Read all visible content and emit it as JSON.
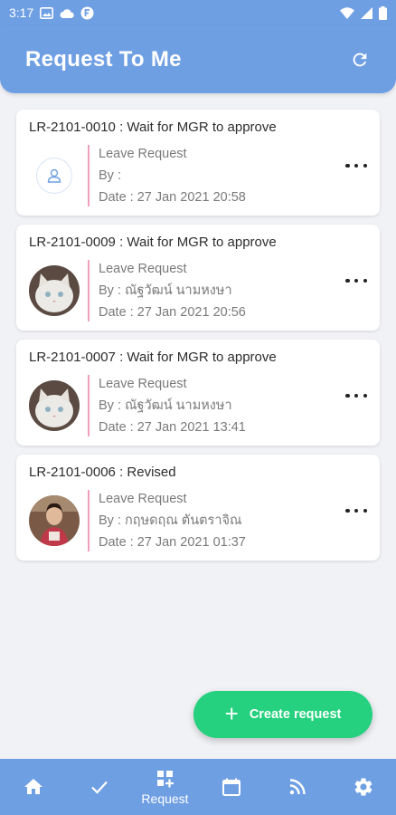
{
  "status_bar": {
    "time": "3:17"
  },
  "header": {
    "title": "Request To Me"
  },
  "requests": [
    {
      "title": "LR-2101-0010 : Wait for MGR to approve",
      "type": "Leave Request",
      "by": "By :",
      "date": "Date : 27 Jan 2021 20:58",
      "avatar": "placeholder"
    },
    {
      "title": "LR-2101-0009 : Wait for MGR to approve",
      "type": "Leave Request",
      "by": "By : ณัฐวัฒน์ นามหงษา",
      "date": "Date : 27 Jan 2021 20:56",
      "avatar": "cat"
    },
    {
      "title": "LR-2101-0007 : Wait for MGR to approve",
      "type": "Leave Request",
      "by": "By : ณัฐวัฒน์ นามหงษา",
      "date": "Date : 27 Jan 2021 13:41",
      "avatar": "cat"
    },
    {
      "title": "LR-2101-0006 : Revised",
      "type": "Leave Request",
      "by": "By : กฤษดฤณ ตันตราจิณ",
      "date": "Date : 27 Jan 2021 01:37",
      "avatar": "person"
    }
  ],
  "fab": {
    "label": "Create request"
  },
  "bottom_nav": {
    "request_label": "Request"
  },
  "colors": {
    "primary": "#6f9fe3",
    "accent": "#25d17e",
    "divider": "#ef9fbb",
    "background": "#f1f2f6"
  }
}
